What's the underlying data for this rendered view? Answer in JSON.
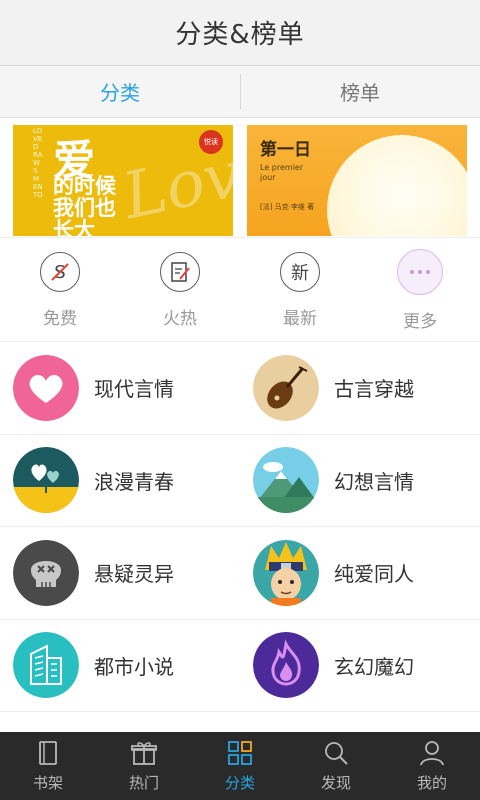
{
  "header": {
    "title": "分类&榜单"
  },
  "tabs": [
    {
      "label": "分类",
      "active": true
    },
    {
      "label": "榜单",
      "active": false
    }
  ],
  "banners": [
    {
      "title_big": "爱",
      "lines": [
        "的时候",
        "我们也",
        "长大"
      ],
      "side_text": "LOVE DRAWS MEN TO",
      "script_text": "Love",
      "seal_text": "悦读"
    },
    {
      "title": "第一日",
      "subtitle": "Le premier jour",
      "author": "[法] 马克·李维 著"
    }
  ],
  "quick_links": [
    {
      "label": "免费",
      "icon": "free-icon",
      "glyph": "S"
    },
    {
      "label": "火热",
      "icon": "hot-icon",
      "glyph": "✎"
    },
    {
      "label": "最新",
      "icon": "new-icon",
      "glyph": "新"
    },
    {
      "label": "更多",
      "icon": "more-icon",
      "glyph": "···"
    }
  ],
  "categories": [
    {
      "label": "现代言情",
      "icon": "heart-icon",
      "color": "#f06496"
    },
    {
      "label": "古言穿越",
      "icon": "pipa-icon",
      "color": "#e9cf9f"
    },
    {
      "label": "浪漫青春",
      "icon": "hearts-icon",
      "color": "#1b5a5e"
    },
    {
      "label": "幻想言情",
      "icon": "mountain-icon",
      "color": "#76cfe6"
    },
    {
      "label": "悬疑灵异",
      "icon": "skull-icon",
      "color": "#4a4a4a"
    },
    {
      "label": "纯爱同人",
      "icon": "ninja-icon",
      "color": "#ffffff"
    },
    {
      "label": "都市小说",
      "icon": "building-icon",
      "color": "#29bfc0"
    },
    {
      "label": "玄幻魔幻",
      "icon": "flame-icon",
      "color": "#4d2a9a"
    }
  ],
  "bottom_nav": [
    {
      "label": "书架",
      "icon": "bookshelf-icon",
      "active": false
    },
    {
      "label": "热门",
      "icon": "gift-icon",
      "active": false
    },
    {
      "label": "分类",
      "icon": "grid-icon",
      "active": true
    },
    {
      "label": "发现",
      "icon": "search-icon",
      "active": false
    },
    {
      "label": "我的",
      "icon": "profile-icon",
      "active": false
    }
  ],
  "colors": {
    "accent": "#27a3e2",
    "nav_bg": "#2a2a2a"
  }
}
